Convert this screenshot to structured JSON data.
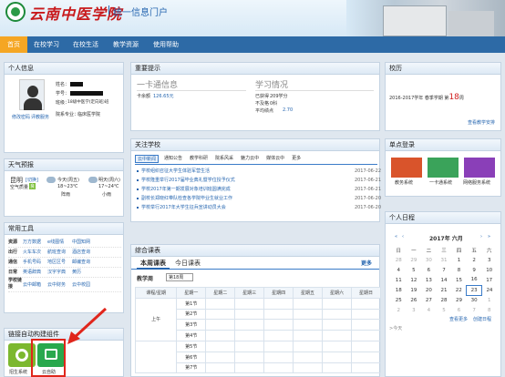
{
  "header": {
    "logo_text": "云南中医学院",
    "portal_title": "统一信息门户"
  },
  "nav": {
    "items": [
      {
        "label": "首页"
      },
      {
        "label": "在校学习"
      },
      {
        "label": "在校生活"
      },
      {
        "label": "教学资源"
      },
      {
        "label": "使用帮助"
      }
    ]
  },
  "personal": {
    "title": "个人信息",
    "name_label": "姓名：",
    "id_label": "学号：",
    "class_label": "班级：",
    "class_value": "18级中医学(定向班)班",
    "college_label": "院系专业：",
    "college_value": "临床医学院",
    "photo_link": "修改密码",
    "eval_link": "评教服务"
  },
  "reminders": {
    "title": "重要提示",
    "card_title": "一卡通信息",
    "card_balance_label": "卡余额",
    "card_balance": "126.65元",
    "study_title": "学习情况",
    "earned_label": "已获得",
    "earned_value": "209学分",
    "fail_label": "不及格",
    "fail_value": "0科",
    "gpa_label": "平均绩点",
    "gpa_value": "2.70"
  },
  "calendar_term": {
    "title": "校历",
    "term": "2016-2017学年 春季学期 第",
    "week": "18",
    "week_suffix": "周",
    "link": "查看教学安排"
  },
  "weather": {
    "title": "天气预报",
    "city": "昆明",
    "city_sub": "[切换]",
    "air_label": "空气质量",
    "air_value": "良",
    "today_label": "今天(周五)",
    "today_temp": "18~23℃",
    "today_desc": "阵雨",
    "tomorrow_label": "明天(周六)",
    "tomorrow_temp": "17~24℃",
    "tomorrow_desc": "小雨"
  },
  "news": {
    "title": "关注学校",
    "tabs": [
      {
        "label": "云中新闻"
      },
      {
        "label": "通知公告"
      },
      {
        "label": "教学科研"
      },
      {
        "label": "院系风采"
      },
      {
        "label": "魅力云中"
      },
      {
        "label": "媒体云中"
      },
      {
        "label": "更多"
      }
    ],
    "items": [
      {
        "title": "学校组织召征大学生体验军营生活",
        "date": "2017-06-22"
      },
      {
        "title": "学校隆重举行2017届毕业典礼暨学位授予仪式",
        "date": "2017-06-21"
      },
      {
        "title": "学校2017年第一期发展对象培训班圆满完成",
        "date": "2017-06-21"
      },
      {
        "title": "副校长郑晓红带队检查各学院毕业生就业工作",
        "date": "2017-06-20"
      },
      {
        "title": "学校举行2017年大学生征兵宣讲动员大会",
        "date": "2017-06-20"
      }
    ]
  },
  "sso": {
    "title": "单点登录",
    "items": [
      {
        "label": "教务系统"
      },
      {
        "label": "一卡通系统"
      },
      {
        "label": "网络服务系统"
      }
    ]
  },
  "tools": {
    "title": "常用工具",
    "rows": [
      {
        "label": "资源",
        "c1": "万方数据",
        "c2": "e线图情",
        "c3": "中国知网"
      },
      {
        "label": "出行",
        "c1": "火车车次",
        "c2": "航班查询",
        "c3": "酒店查询"
      },
      {
        "label": "通信",
        "c1": "手机号码",
        "c2": "地区区号",
        "c3": "邮编查询"
      },
      {
        "label": "日常",
        "c1": "英语辞典",
        "c2": "汉字字典",
        "c3": "黄历"
      },
      {
        "label": "学校链接",
        "c1": "云中邮箱",
        "c2": "云中财务",
        "c3": "云中校园"
      }
    ]
  },
  "schedule": {
    "title": "综合课表",
    "tab_week": "本周课表",
    "tab_today": "今日课表",
    "more": "更多",
    "week_label": "教学周",
    "week_value": "第18周",
    "headers": [
      "课程/星期",
      "星期一",
      "星期二",
      "星期三",
      "星期四",
      "星期五",
      "星期六",
      "星期日"
    ],
    "period_group": "上午",
    "periods": [
      "第1节",
      "第2节",
      "第3节",
      "第4节",
      "第5节",
      "第6节",
      "第7节"
    ]
  },
  "agenda": {
    "title": "个人日程",
    "month": "2017年 六月",
    "weekdays": [
      "日",
      "一",
      "二",
      "三",
      "四",
      "五",
      "六"
    ],
    "weeks": [
      [
        "28",
        "29",
        "30",
        "31",
        "1",
        "2",
        "3"
      ],
      [
        "4",
        "5",
        "6",
        "7",
        "8",
        "9",
        "10"
      ],
      [
        "11",
        "12",
        "13",
        "14",
        "15",
        "16",
        "17"
      ],
      [
        "18",
        "19",
        "20",
        "21",
        "22",
        "23",
        "24"
      ],
      [
        "25",
        "26",
        "27",
        "28",
        "29",
        "30",
        "1"
      ],
      [
        "2",
        "3",
        "4",
        "5",
        "6",
        "7",
        "8"
      ]
    ],
    "link_more": "查看更多",
    "link_create": "创建日程",
    "today_link": ">今天"
  },
  "widgets": {
    "title": "链接自动构建组件",
    "items": [
      {
        "label": "招生系统"
      },
      {
        "label": "云自助"
      }
    ]
  }
}
